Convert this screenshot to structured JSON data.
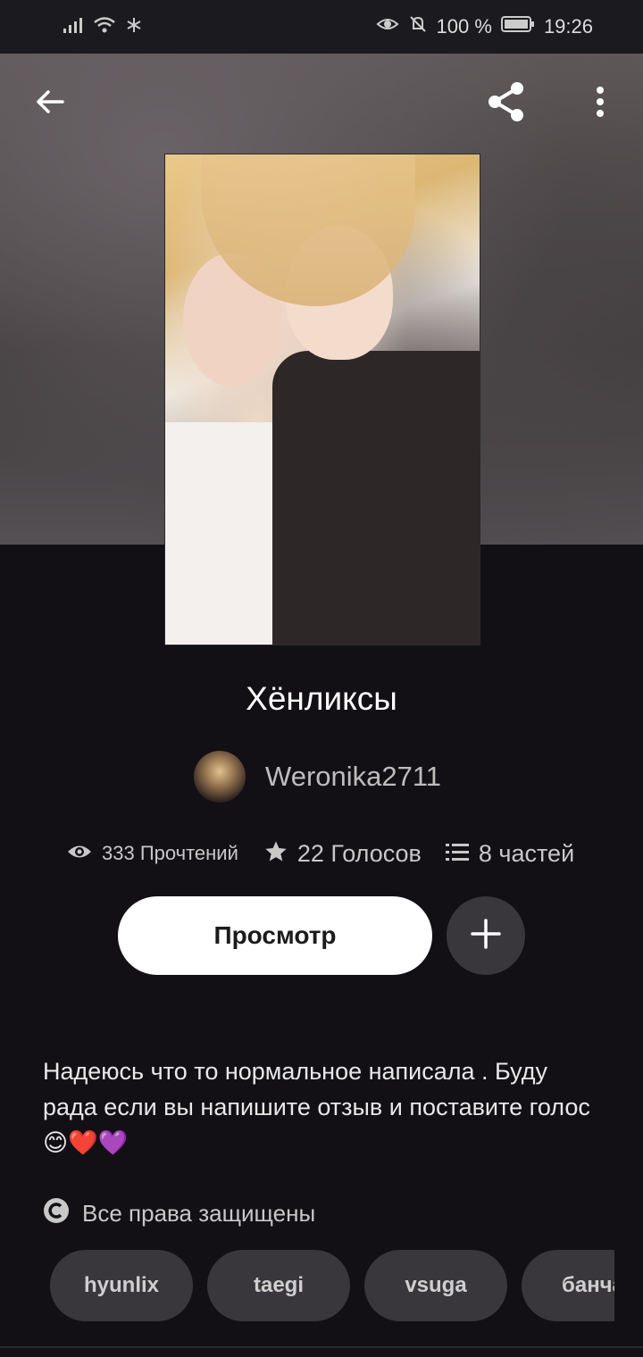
{
  "status_bar": {
    "battery": "100 %",
    "time": "19:26"
  },
  "story": {
    "title": "Хёнликсы",
    "author": "Weronika2711",
    "reads": "333 Прочтений",
    "votes": "22 Голосов",
    "parts": "8 частей",
    "description_text": "Надеюсь что то нормальное написала . Буду рада если вы напишите отзыв и поставите голос",
    "description_emoji": "😊❤️💜",
    "copyright": "Все права защищены",
    "tags": [
      "hyunlix",
      "taegi",
      "vsuga",
      "банча"
    ]
  },
  "actions": {
    "view_label": "Просмотр"
  },
  "icons": {
    "back": "arrow-left-icon",
    "share": "share-icon",
    "menu": "more-vertical-icon",
    "add": "plus-icon",
    "reads": "eye-icon",
    "votes": "star-icon",
    "parts": "list-icon",
    "copyright": "copyright-icon"
  }
}
